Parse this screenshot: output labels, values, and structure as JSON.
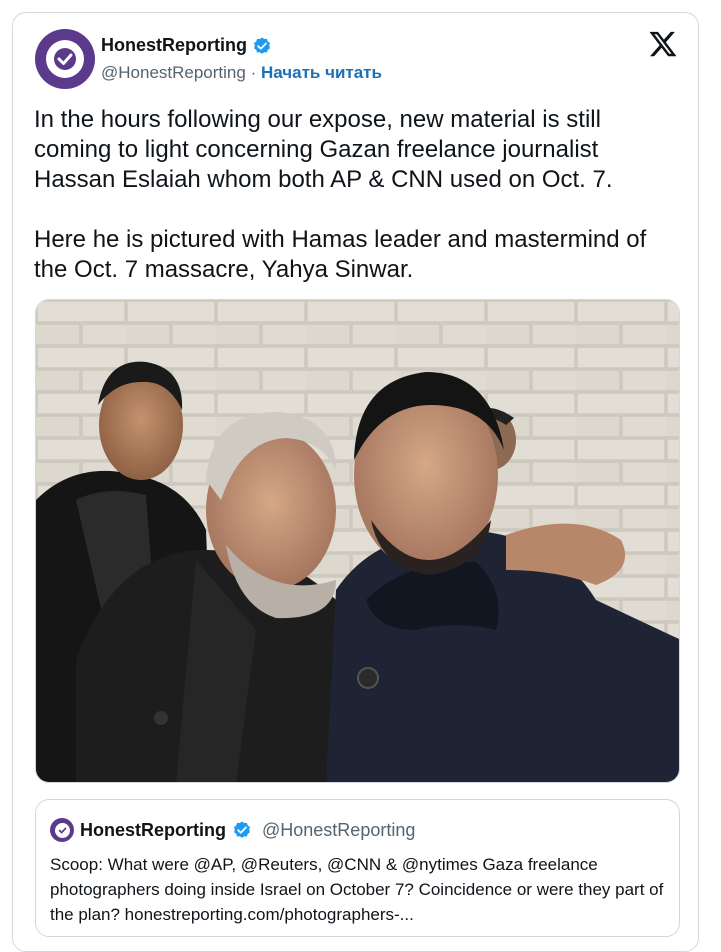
{
  "header": {
    "display_name": "HonestReporting",
    "handle": "@HonestReporting",
    "separator": " · ",
    "follow_label": "Начать читать",
    "platform_icon": "x-logo-icon"
  },
  "tweet": {
    "text": "In the hours following our expose, new material is still coming to light concerning Gazan freelance journalist Hassan Eslaiah whom both AP & CNN used on Oct. 7.\n\nHere he is pictured with Hamas leader and mastermind of the Oct. 7 massacre, Yahya Sinwar."
  },
  "media": {
    "type": "photo"
  },
  "quoted_tweet": {
    "display_name": "HonestReporting",
    "handle": "@HonestReporting",
    "text": "Scoop: What were @AP, @Reuters, @CNN & @nytimes Gaza freelance photographers doing inside Israel on October 7? Coincidence or were they part of the plan? honestreporting.com/photographers-..."
  },
  "colors": {
    "brand_avatar": "#5b3a8c",
    "verified": "#1d9bf0",
    "follow_link": "#1d6fb8",
    "secondary_text": "#536471",
    "border": "#cfd9de"
  }
}
